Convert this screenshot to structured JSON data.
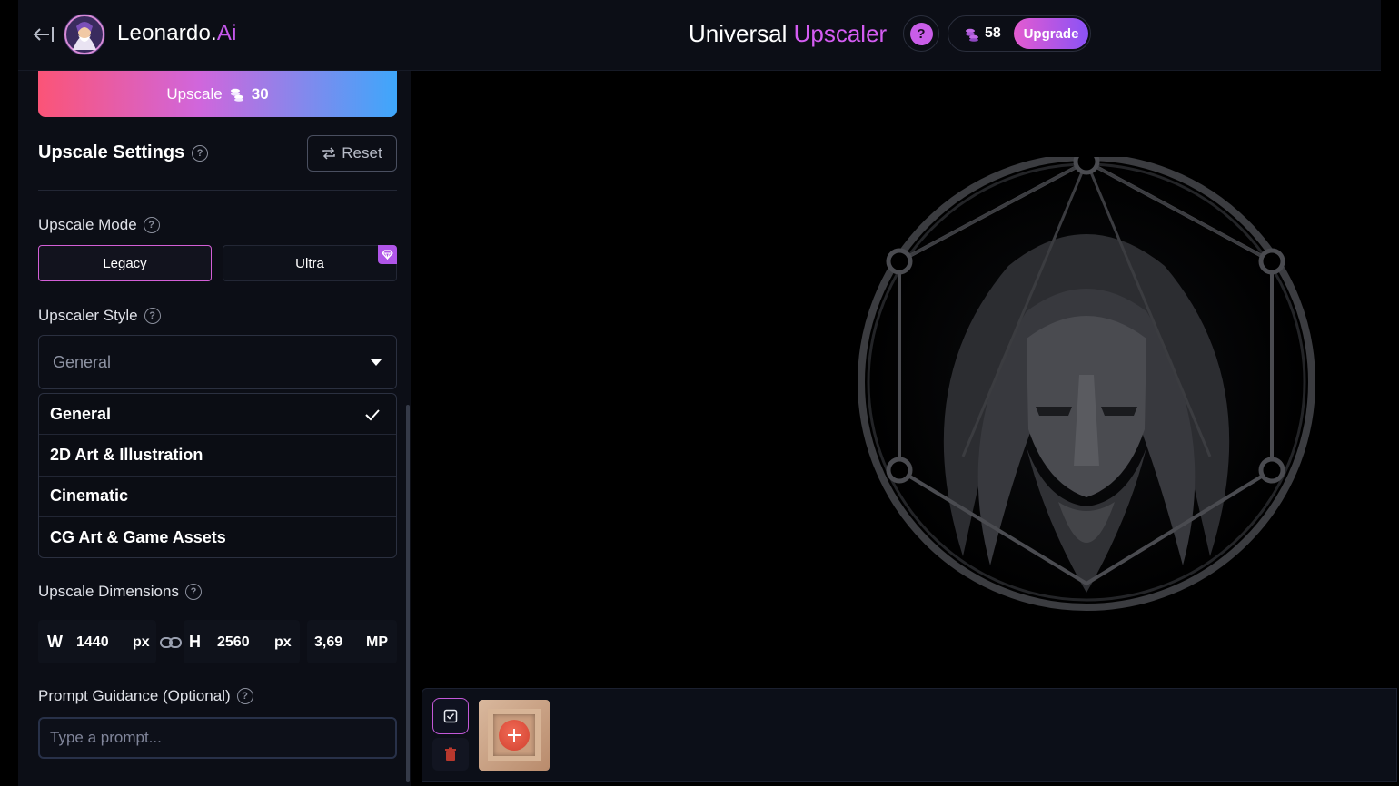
{
  "header": {
    "brand_name": "Leonardo.",
    "brand_suffix": "Ai",
    "page_title": "Universal",
    "page_title_accent": "Upscaler",
    "help_label": "?",
    "credits": "58",
    "upgrade_label": "Upgrade"
  },
  "sidebar": {
    "upscale_button": {
      "label": "Upscale",
      "cost": "30"
    },
    "settings_title": "Upscale Settings",
    "reset_label": "Reset",
    "mode": {
      "label": "Upscale Mode",
      "options": [
        "Legacy",
        "Ultra"
      ],
      "selected": "Legacy"
    },
    "style": {
      "label": "Upscaler Style",
      "selected": "General",
      "options": [
        "General",
        "2D Art & Illustration",
        "Cinematic",
        "CG Art & Game Assets"
      ]
    },
    "dimensions": {
      "label": "Upscale Dimensions",
      "w_key": "W",
      "w_value": "1440",
      "w_unit": "px",
      "h_key": "H",
      "h_value": "2560",
      "h_unit": "px",
      "mp_value": "3,69",
      "mp_unit": "MP"
    },
    "prompt": {
      "label": "Prompt Guidance (Optional)",
      "placeholder": "Type a prompt..."
    }
  },
  "icons": {
    "back": "arrow-left-bar-icon",
    "help": "question-circle-icon",
    "coins": "coins-icon",
    "reset": "repeat-arrows-icon",
    "gem": "gem-icon",
    "caret": "caret-down-icon",
    "check": "checkmark-icon",
    "link": "chain-link-icon",
    "select_all": "checkbox-icon",
    "delete": "trash-icon",
    "add": "plus-icon"
  },
  "colors": {
    "accent": "#d45cf2",
    "upscale_gradient": [
      "#fb5477",
      "#3ea7fb"
    ],
    "delete": "#c0392b"
  }
}
